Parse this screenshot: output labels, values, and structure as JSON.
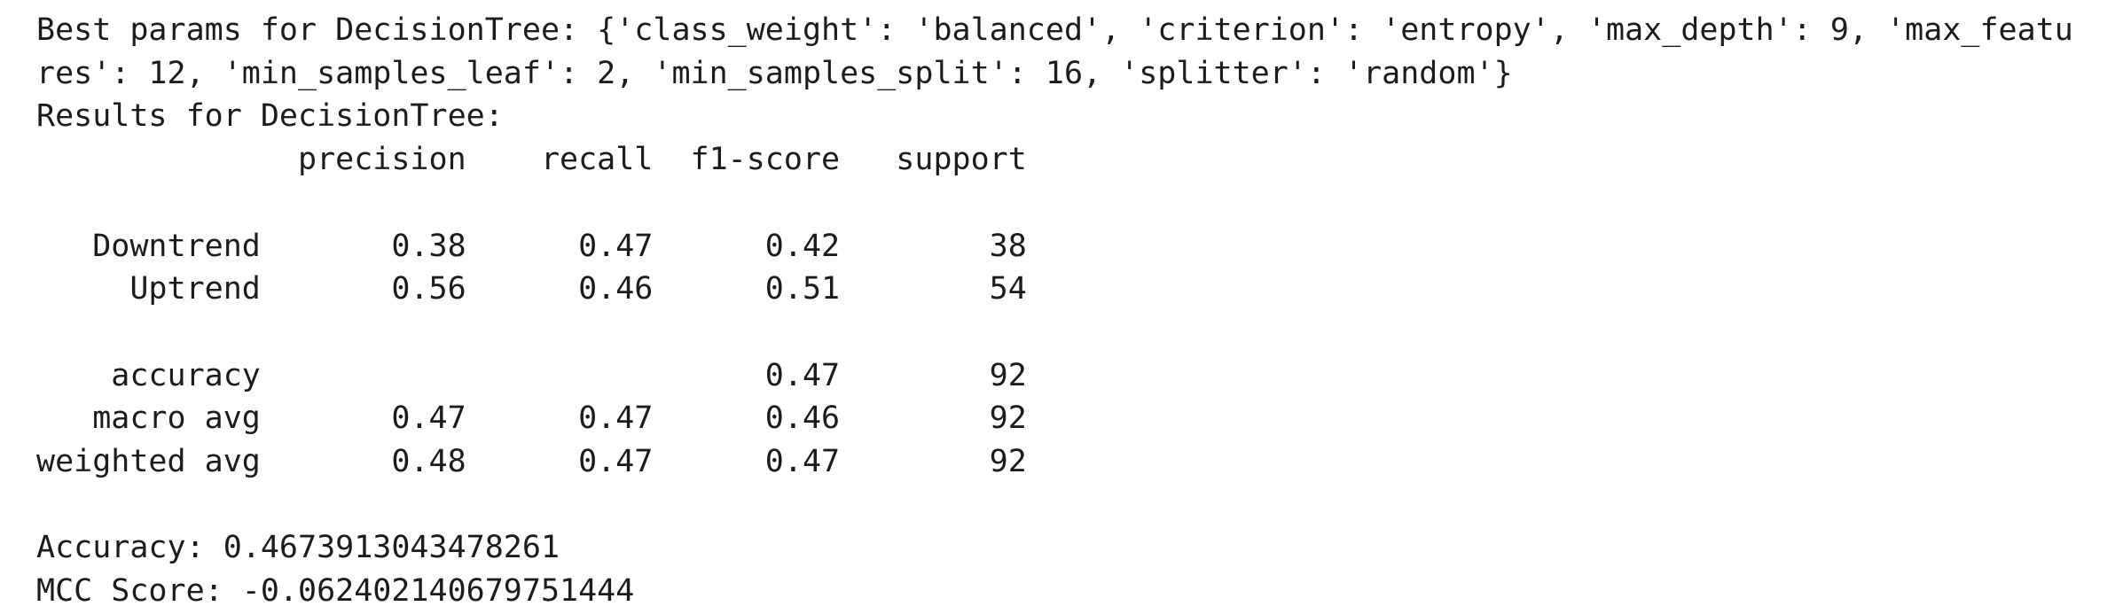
{
  "output": {
    "lines": [
      "Best params for DecisionTree: {'class_weight': 'balanced', 'criterion': 'entropy', 'max_depth': 9, 'max_featu",
      "res': 12, 'min_samples_leaf': 2, 'min_samples_split': 16, 'splitter': 'random'}",
      "Results for DecisionTree:",
      "              precision    recall  f1-score   support",
      "",
      "   Downtrend       0.38      0.47      0.42        38",
      "     Uptrend       0.56      0.46      0.51        54",
      "",
      "    accuracy                           0.47        92",
      "   macro avg       0.47      0.47      0.46        92",
      "weighted avg       0.48      0.47      0.47        92",
      "",
      "Accuracy: 0.4673913043478261",
      "MCC Score: -0.062402140679751444"
    ]
  }
}
